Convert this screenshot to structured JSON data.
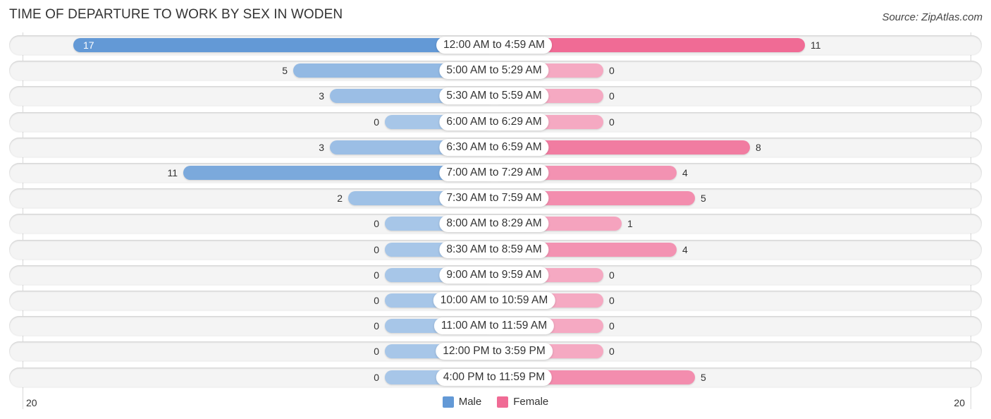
{
  "header": {
    "title": "TIME OF DEPARTURE TO WORK BY SEX IN WODEN",
    "source": "Source: ZipAtlas.com"
  },
  "colors": {
    "male_strong": "#6399d6",
    "male_light": "#a7c6e8",
    "female_strong": "#f06b95",
    "female_light": "#f5a9c2"
  },
  "legend": [
    {
      "name": "Male",
      "color": "#6399d6"
    },
    {
      "name": "Female",
      "color": "#f06b95"
    }
  ],
  "chart_data": {
    "type": "bar",
    "orientation": "horizontal-diverging",
    "title": "TIME OF DEPARTURE TO WORK BY SEX IN WODEN",
    "categories": [
      "12:00 AM to 4:59 AM",
      "5:00 AM to 5:29 AM",
      "5:30 AM to 5:59 AM",
      "6:00 AM to 6:29 AM",
      "6:30 AM to 6:59 AM",
      "7:00 AM to 7:29 AM",
      "7:30 AM to 7:59 AM",
      "8:00 AM to 8:29 AM",
      "8:30 AM to 8:59 AM",
      "9:00 AM to 9:59 AM",
      "10:00 AM to 10:59 AM",
      "11:00 AM to 11:59 AM",
      "12:00 PM to 3:59 PM",
      "4:00 PM to 11:59 PM"
    ],
    "series": [
      {
        "name": "Male",
        "side": "left",
        "values": [
          17,
          5,
          3,
          0,
          3,
          11,
          2,
          0,
          0,
          0,
          0,
          0,
          0,
          0
        ]
      },
      {
        "name": "Female",
        "side": "right",
        "values": [
          11,
          0,
          0,
          0,
          8,
          4,
          5,
          1,
          4,
          0,
          0,
          0,
          0,
          5
        ]
      }
    ],
    "axis": {
      "left_label": "20",
      "right_label": "20",
      "range": [
        0,
        20
      ]
    },
    "legend_position": "bottom-center",
    "grid": false
  }
}
